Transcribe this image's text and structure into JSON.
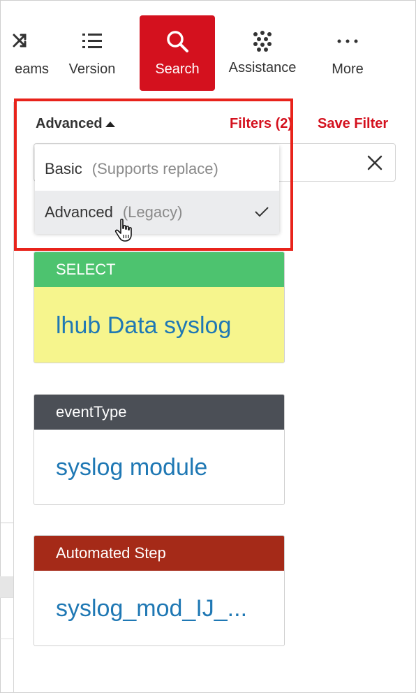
{
  "toolbar": {
    "items": [
      {
        "label": "eams",
        "icon": "shuffle-icon"
      },
      {
        "label": "Version",
        "icon": "list-icon"
      },
      {
        "label": "Search",
        "icon": "search-icon",
        "active": true
      },
      {
        "label": "Assistance",
        "icon": "dots-grid-icon"
      },
      {
        "label": "More",
        "icon": "more-horizontal-icon"
      }
    ],
    "active_color": "#d4111e"
  },
  "search_header": {
    "mode_label": "Advanced",
    "filters_label": "Filters (2)",
    "save_filter_label": "Save Filter"
  },
  "mode_dropdown": {
    "options": [
      {
        "label": "Basic",
        "hint": "(Supports replace)",
        "selected": false
      },
      {
        "label": "Advanced",
        "hint": "(Legacy)",
        "selected": true
      }
    ]
  },
  "cards": [
    {
      "header": "SELECT",
      "value": "lhub Data syslog",
      "header_color": "#4dc36f",
      "body_color": "#f6f58d"
    },
    {
      "header": "eventType",
      "value": "syslog module",
      "header_color": "#4b4f56"
    },
    {
      "header": "Automated Step",
      "value": "syslog_mod_IJ_...",
      "header_color": "#a52a18"
    }
  ],
  "colors": {
    "accent": "#d4111e",
    "link_blue": "#1f78b4",
    "highlight": "#e8231b"
  }
}
